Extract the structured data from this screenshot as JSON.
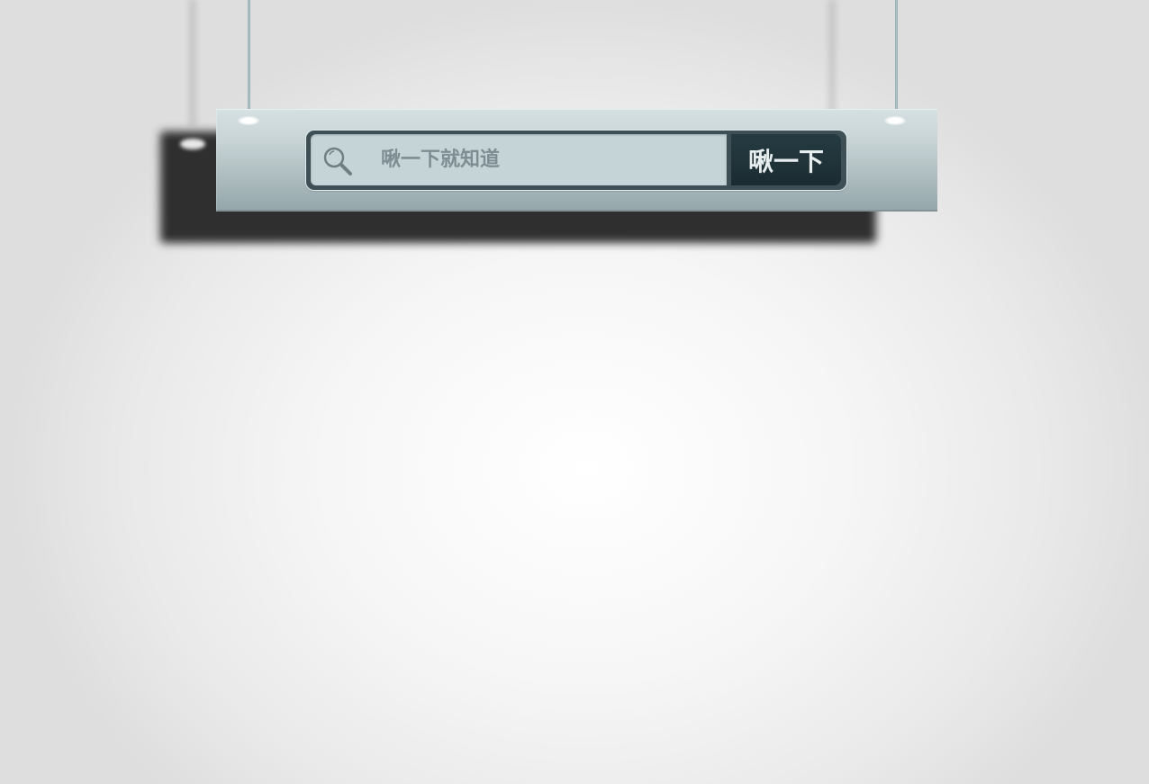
{
  "search": {
    "placeholder": "啾一下就知道",
    "value": "",
    "button_label": "啾一下"
  },
  "icons": {
    "search": "search-icon"
  },
  "colors": {
    "board": "#c8d4d6",
    "field": "#c5d5d7",
    "button": "#21343a",
    "button_text": "#e8eeef",
    "placeholder": "#7d8d92"
  }
}
